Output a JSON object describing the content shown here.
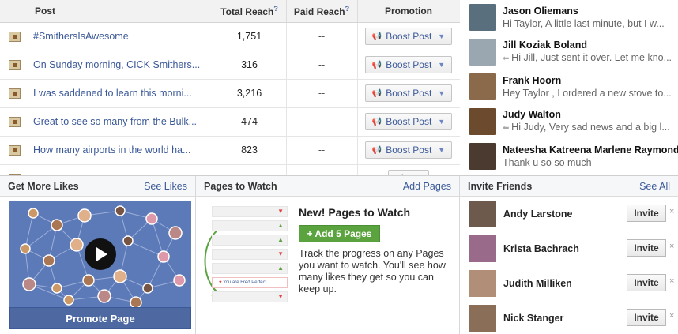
{
  "posts": {
    "headers": {
      "post": "Post",
      "total_reach": "Total Reach",
      "paid_reach": "Paid Reach",
      "promotion": "Promotion",
      "help": "?"
    },
    "rows": [
      {
        "title": "#SmithersIsAwesome",
        "reach": "1,751",
        "paid": "--",
        "promo": "Boost Post"
      },
      {
        "title": "On Sunday morning, CICK Smithers...",
        "reach": "316",
        "paid": "--",
        "promo": "Boost Post"
      },
      {
        "title": "I was saddened to learn this morni...",
        "reach": "3,216",
        "paid": "--",
        "promo": "Boost Post"
      },
      {
        "title": "Great to see so many from the Bulk...",
        "reach": "474",
        "paid": "--",
        "promo": "Boost Post"
      },
      {
        "title": "How many airports in the world ha...",
        "reach": "823",
        "paid": "--",
        "promo": "Boost Post"
      },
      {
        "title": "",
        "reach": "",
        "paid": "",
        "promo": ""
      }
    ]
  },
  "messages": [
    {
      "name": "Jason Oliemans",
      "preview": "Hi Taylor, A little last minute, but I w...",
      "replied": false,
      "avatar_color": "#5a6f7e"
    },
    {
      "name": "Jill Koziak Boland",
      "preview": "Hi Jill, Just sent it over. Let me kno...",
      "replied": true,
      "avatar_color": "#9aa6b0"
    },
    {
      "name": "Frank Hoorn",
      "preview": "Hey Taylor , I ordered a new stove to...",
      "replied": false,
      "avatar_color": "#8a6a4a"
    },
    {
      "name": "Judy Walton",
      "preview": "Hi Judy, Very sad news and a big l...",
      "replied": true,
      "avatar_color": "#6b4a2e"
    },
    {
      "name": "Nateesha Katreena Marlene Raymond",
      "preview": "Thank u so so much",
      "replied": false,
      "avatar_color": "#4a3a30"
    }
  ],
  "likes": {
    "title": "Get More Likes",
    "link": "See Likes",
    "button": "Promote Page"
  },
  "watch": {
    "title": "Pages to Watch",
    "link": "Add Pages",
    "new_title": "New! Pages to Watch",
    "add_button": "+ Add 5 Pages",
    "description": "Track the progress on any Pages you want to watch. You'll see how many likes they get so you can keep up.",
    "mock_label": "You are Fred Perfect"
  },
  "invite": {
    "title": "Invite Friends",
    "link": "See All",
    "button": "Invite",
    "dismiss": "×",
    "friends": [
      {
        "name": "Andy Larstone",
        "avatar_color": "#6e5a4c"
      },
      {
        "name": "Krista Bachrach",
        "avatar_color": "#9a6a8a"
      },
      {
        "name": "Judith Milliken",
        "avatar_color": "#b08e78"
      },
      {
        "name": "Nick Stanger",
        "avatar_color": "#8a6e58"
      }
    ]
  },
  "icons": {
    "post_icon": "photo-post-icon",
    "megaphone": "megaphone-icon",
    "caret": "caret-down-icon",
    "reply": "reply-arrow-icon",
    "play": "play-icon",
    "close": "close-icon"
  },
  "colors": {
    "link": "#3b5998",
    "add_button": "#5aa33e",
    "promote_button": "#4e69a2"
  }
}
